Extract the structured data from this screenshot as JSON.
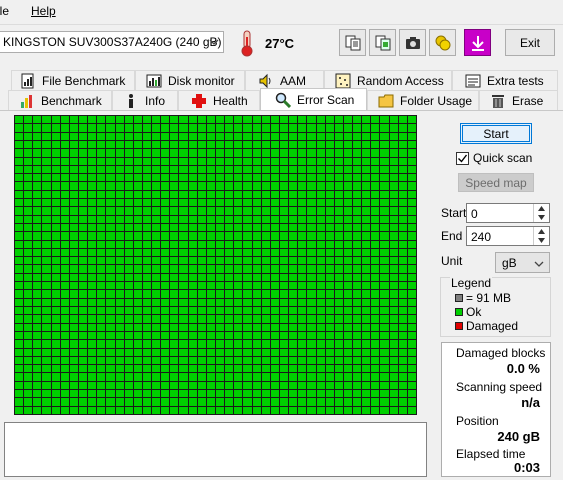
{
  "menu": {
    "file": "ile",
    "help": "Help"
  },
  "toolbar": {
    "drive": "KINGSTON SUV300S37A240G (240 gB)",
    "temperature": "27°C",
    "exit_label": "Exit",
    "buttons": [
      "copy-text-icon",
      "copy-screenshot-icon",
      "camera-icon",
      "coins-icon",
      "download-icon"
    ]
  },
  "tabs": {
    "row1": [
      {
        "label": "File Benchmark",
        "icon": "file-benchmark-icon"
      },
      {
        "label": "Disk monitor",
        "icon": "disk-monitor-icon"
      },
      {
        "label": "AAM",
        "icon": "speaker-icon"
      },
      {
        "label": "Random Access",
        "icon": "random-access-icon"
      },
      {
        "label": "Extra tests",
        "icon": "extra-tests-icon"
      }
    ],
    "row2": [
      {
        "label": "Benchmark",
        "icon": "benchmark-icon"
      },
      {
        "label": "Info",
        "icon": "info-icon"
      },
      {
        "label": "Health",
        "icon": "health-cross-icon"
      },
      {
        "label": "Error Scan",
        "icon": "magnifier-icon",
        "active": true
      },
      {
        "label": "Folder Usage",
        "icon": "folder-icon"
      },
      {
        "label": "Erase",
        "icon": "trash-icon"
      }
    ]
  },
  "scan": {
    "start_label": "Start",
    "quick_scan_label": "Quick scan",
    "quick_scan_checked": true,
    "speed_map_label": "Speed map",
    "start_field_label": "Start",
    "start_value": "0",
    "end_field_label": "End",
    "end_value": "240",
    "unit_label": "Unit",
    "unit_value": "gB",
    "block_color": "#00d000"
  },
  "legend": {
    "title": "Legend",
    "block_size": "= 91 MB",
    "ok": "Ok",
    "damaged": "Damaged",
    "colors": {
      "block": "#808080",
      "ok": "#00d000",
      "damaged": "#e00000"
    }
  },
  "stats": {
    "damaged_label": "Damaged blocks",
    "damaged_value": "0.0 %",
    "speed_label": "Scanning speed",
    "speed_value": "n/a",
    "position_label": "Position",
    "position_value": "240 gB",
    "elapsed_label": "Elapsed time",
    "elapsed_value": "0:03"
  }
}
